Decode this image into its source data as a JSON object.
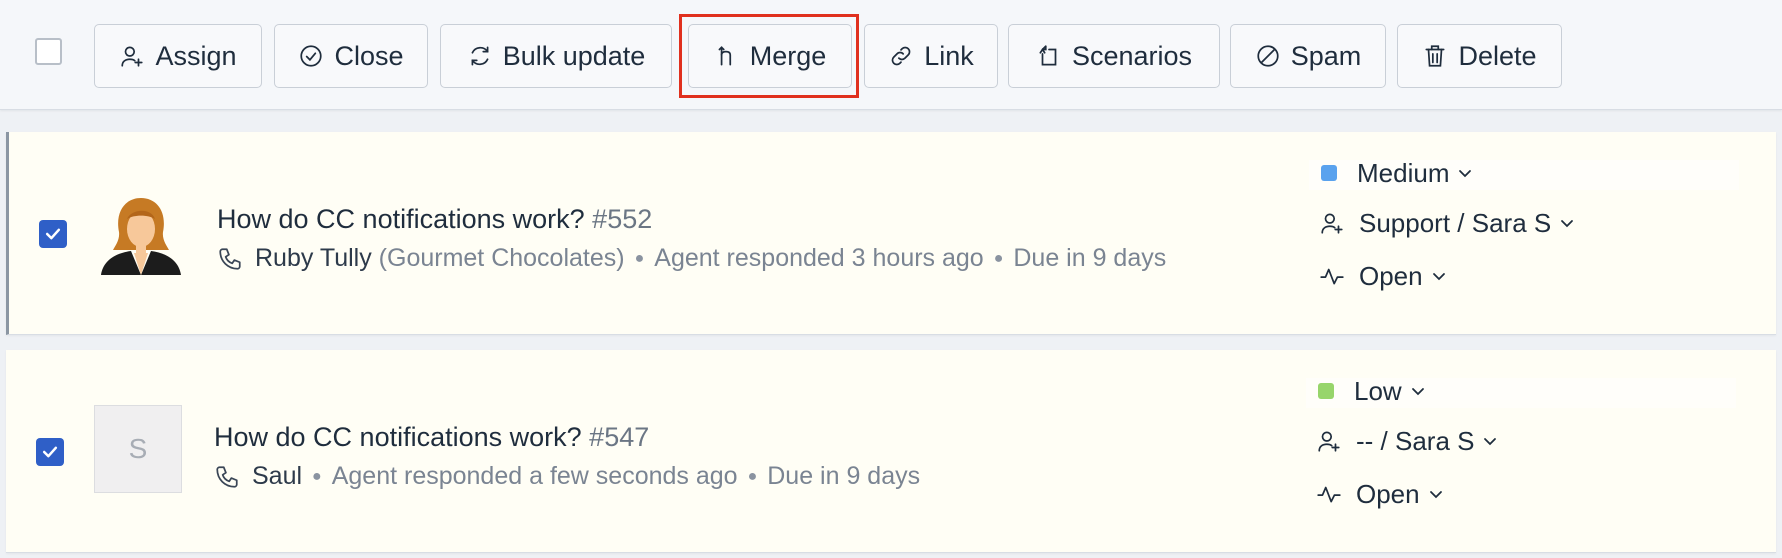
{
  "toolbar": {
    "assign": "Assign",
    "close": "Close",
    "bulk_update": "Bulk update",
    "merge": "Merge",
    "link": "Link",
    "scenarios": "Scenarios",
    "spam": "Spam",
    "delete": "Delete"
  },
  "tickets": [
    {
      "title": "How do CC notifications work?",
      "number": "#552",
      "contact": "Ruby Tully",
      "company": "(Gourmet Chocolates)",
      "activity": "Agent responded 3 hours ago",
      "due": "Due in 9 days",
      "priority": "Medium",
      "priority_color": "#5aa2ee",
      "assignee": "Support / Sara S",
      "status": "Open",
      "avatar_initial": "",
      "checked": true
    },
    {
      "title": "How do CC notifications work?",
      "number": "#547",
      "contact": "Saul",
      "company": "",
      "activity": "Agent responded a few seconds ago",
      "due": "Due in 9 days",
      "priority": "Low",
      "priority_color": "#97d56b",
      "assignee": "-- / Sara S",
      "status": "Open",
      "avatar_initial": "S",
      "checked": true
    }
  ],
  "colors": {
    "accent": "#2f5fc7",
    "highlight": "#e0301e",
    "row_bg": "#fffef5"
  }
}
